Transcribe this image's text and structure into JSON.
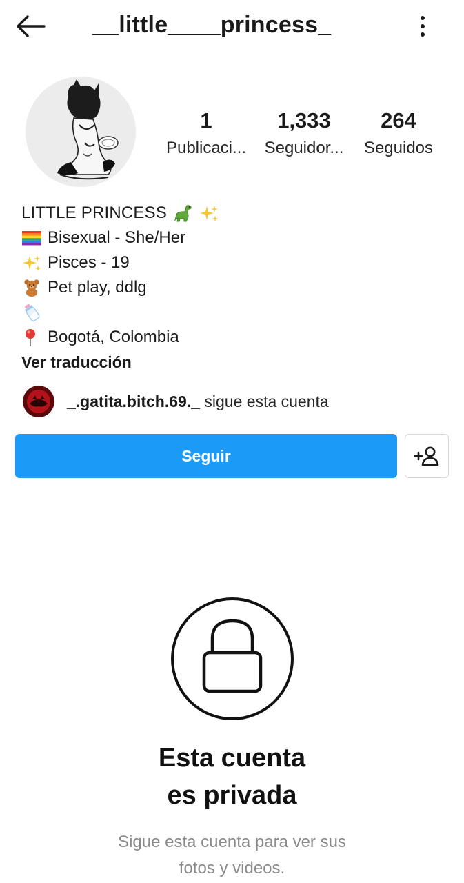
{
  "header": {
    "back_icon": "arrow-left-icon",
    "username": "__little____princess_",
    "more_icon": "more-vertical-icon"
  },
  "profile": {
    "avatar_icon": "profile-avatar-illustration",
    "stats": {
      "posts": {
        "value": "1",
        "label": "Publicaci..."
      },
      "followers": {
        "value": "1,333",
        "label": "Seguidor..."
      },
      "following": {
        "value": "264",
        "label": "Seguidos"
      }
    }
  },
  "bio": {
    "name": "LITTLE PRINCESS",
    "name_emojis": [
      "dinosaur-emoji",
      "sparkles-emoji"
    ],
    "lines": [
      {
        "emoji": "rainbow-flag-emoji",
        "text": "Bisexual - She/Her"
      },
      {
        "emoji": "sparkles-emoji",
        "text": "Pisces - 19"
      },
      {
        "emoji": "teddy-bear-emoji",
        "text": "Pet play, ddlg"
      },
      {
        "emoji": "baby-bottle-emoji",
        "text": ""
      },
      {
        "emoji": "round-pushpin-emoji",
        "text": "Bogotá, Colombia"
      }
    ],
    "translate_link": "Ver traducción"
  },
  "mutual": {
    "username": "_.gatita.bitch.69._",
    "suffix": " sigue esta cuenta"
  },
  "actions": {
    "follow_label": "Seguir",
    "suggest_icon": "add-person-icon"
  },
  "private": {
    "lock_icon": "lock-icon",
    "title_line1": "Esta cuenta",
    "title_line2": "es privada",
    "subtitle_line1": "Sigue esta cuenta para ver sus",
    "subtitle_line2": "fotos y videos."
  },
  "colors": {
    "follow_button": "#1b9af7",
    "text": "#1a1a1a",
    "muted_text": "#8a8a8a",
    "border": "#d6d6d6"
  }
}
